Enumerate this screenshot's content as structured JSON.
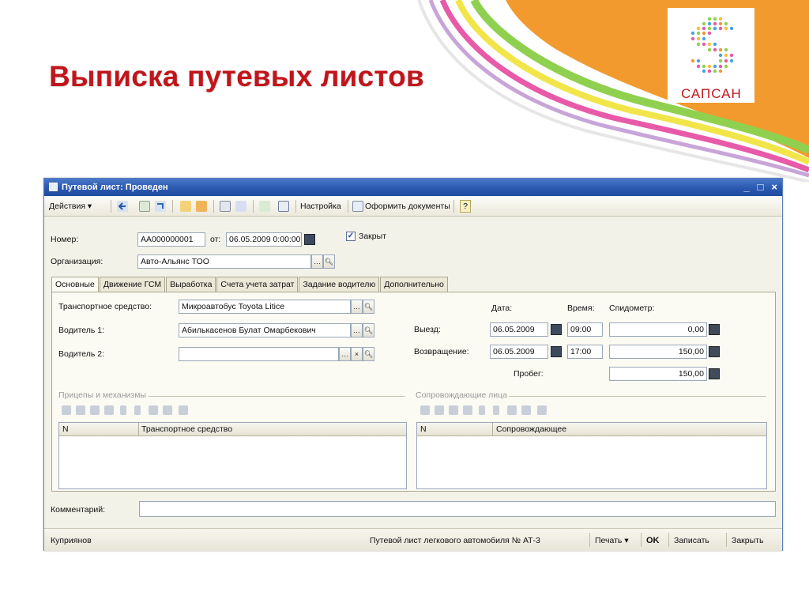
{
  "slide": {
    "title": "Выписка путевых листов",
    "logo_text": "САПСАН"
  },
  "window": {
    "title": "Путевой лист: Проведен",
    "controls": [
      "_",
      "□",
      "×"
    ]
  },
  "toolbar": {
    "actions_label": "Действия ▾",
    "settings_label": "Настройка",
    "create_docs_label": "Оформить документы",
    "help_label": "?"
  },
  "header": {
    "number_label": "Номер:",
    "number_value": "АА000000001",
    "from_label": "от:",
    "date_value": "06.05.2009  0:00:00",
    "closed_label": "Закрыт",
    "closed_checked": true,
    "org_label": "Организация:",
    "org_value": "Авто-Альянс ТОО"
  },
  "tabs": [
    {
      "label": "Основные",
      "active": true
    },
    {
      "label": "Движение ГСМ",
      "active": false
    },
    {
      "label": "Выработка",
      "active": false
    },
    {
      "label": "Счета учета затрат",
      "active": false
    },
    {
      "label": "Задание водителю",
      "active": false
    },
    {
      "label": "Дополнительно",
      "active": false
    }
  ],
  "main": {
    "vehicle_label": "Транспортное средство:",
    "vehicle_value": "Микроавтобус Toyota Litice",
    "driver1_label": "Водитель 1:",
    "driver1_value": "Абилькасенов Булат Омарбекович",
    "driver2_label": "Водитель 2:",
    "driver2_value": "",
    "col_date": "Дата:",
    "col_time": "Время:",
    "col_speedo": "Спидометр:",
    "departure_label": "Выезд:",
    "departure_date": "06.05.2009",
    "departure_time": "09:00",
    "departure_speedo": "0,00",
    "return_label": "Возвращение:",
    "return_date": "06.05.2009",
    "return_time": "17:00",
    "return_speedo": "150,00",
    "mileage_label": "Пробег:",
    "mileage_value": "150,00"
  },
  "trailers": {
    "title": "Прицепы и механизмы",
    "col_n": "N",
    "col_vehicle": "Транспортное средство"
  },
  "companions": {
    "title": "Сопровождающие лица",
    "col_n": "N",
    "col_person": "Сопровождающее"
  },
  "comment": {
    "label": "Комментарий:",
    "value": ""
  },
  "status": {
    "user": "Куприянов",
    "doc_name": "Путевой лист легкового автомобиля № АТ-3",
    "print_label": "Печать ▾",
    "ok_label": "OK",
    "save_label": "Записать",
    "close_label": "Закрыть"
  }
}
